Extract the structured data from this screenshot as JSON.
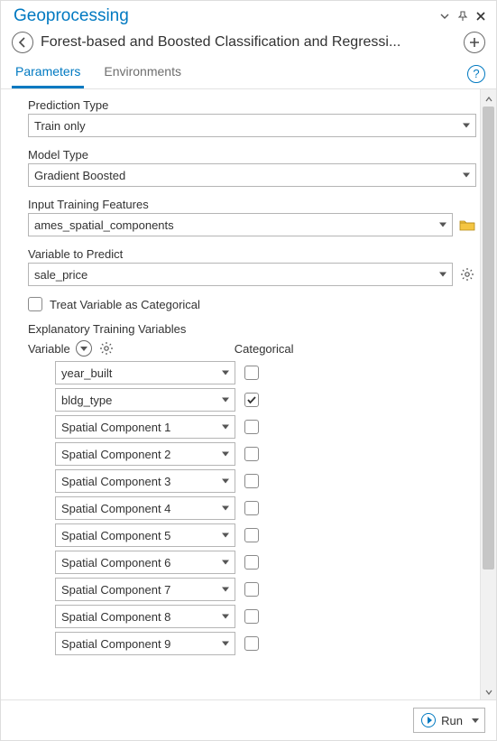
{
  "panel": {
    "title": "Geoprocessing",
    "tool_name": "Forest-based and Boosted Classification and Regressi..."
  },
  "tabs": {
    "parameters": "Parameters",
    "environments": "Environments"
  },
  "fields": {
    "prediction_type": {
      "label": "Prediction Type",
      "value": "Train only"
    },
    "model_type": {
      "label": "Model Type",
      "value": "Gradient Boosted"
    },
    "input_training": {
      "label": "Input Training Features",
      "value": "ames_spatial_components"
    },
    "variable_to_predict": {
      "label": "Variable to Predict",
      "value": "sale_price"
    },
    "treat_categorical": {
      "label": "Treat Variable as Categorical",
      "checked": false
    }
  },
  "explanatory": {
    "section_label": "Explanatory Training Variables",
    "variable_header": "Variable",
    "categorical_header": "Categorical",
    "rows": [
      {
        "value": "year_built",
        "categorical": false
      },
      {
        "value": "bldg_type",
        "categorical": true
      },
      {
        "value": "Spatial Component 1",
        "categorical": false
      },
      {
        "value": "Spatial Component 2",
        "categorical": false
      },
      {
        "value": "Spatial Component 3",
        "categorical": false
      },
      {
        "value": "Spatial Component 4",
        "categorical": false
      },
      {
        "value": "Spatial Component 5",
        "categorical": false
      },
      {
        "value": "Spatial Component 6",
        "categorical": false
      },
      {
        "value": "Spatial Component 7",
        "categorical": false
      },
      {
        "value": "Spatial Component 8",
        "categorical": false
      },
      {
        "value": "Spatial Component 9",
        "categorical": false
      }
    ]
  },
  "footer": {
    "run_label": "Run"
  }
}
